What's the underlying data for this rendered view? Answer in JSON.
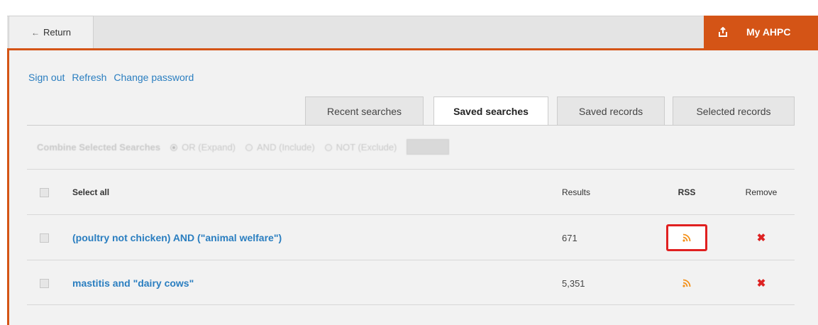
{
  "topbar": {
    "return_label": "Return",
    "myahpc_label": "My AHPC"
  },
  "links": {
    "sign_out": "Sign out",
    "refresh": "Refresh",
    "change_password": "Change password"
  },
  "tabs": [
    {
      "label": "Recent searches",
      "active": false
    },
    {
      "label": "Saved searches",
      "active": true
    },
    {
      "label": "Saved records",
      "active": false
    },
    {
      "label": "Selected records",
      "active": false
    }
  ],
  "combine": {
    "label": "Combine Selected Searches",
    "options": [
      {
        "label": "OR (Expand)",
        "selected": true
      },
      {
        "label": "AND (Include)",
        "selected": false
      },
      {
        "label": "NOT (Exclude)",
        "selected": false
      }
    ]
  },
  "table": {
    "headers": {
      "select_all": "Select all",
      "results": "Results",
      "rss": "RSS",
      "remove": "Remove"
    },
    "rows": [
      {
        "query": "(poultry not chicken) AND (\"animal welfare\")",
        "results": "671",
        "rss_highlighted": true
      },
      {
        "query": "mastitis and \"dairy cows\"",
        "results": "5,351",
        "rss_highlighted": false
      }
    ],
    "remove_glyph": "✖"
  },
  "colors": {
    "accent": "#d45416",
    "link": "#2a7ec0",
    "rss": "#f39019",
    "remove": "#dd2222",
    "highlight": "#e02020"
  }
}
